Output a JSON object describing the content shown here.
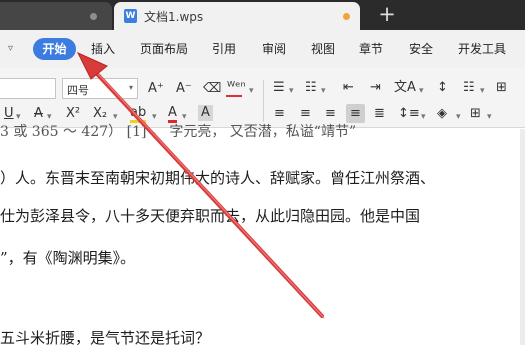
{
  "tabs": {
    "active_title": "文档1.wps",
    "doc_icon_letter": "W",
    "new_tab_symbol": "+"
  },
  "menu": {
    "chevron": "▿",
    "items": [
      "开始",
      "插入",
      "页面布局",
      "引用",
      "审阅",
      "视图",
      "章节",
      "安全",
      "开发工具"
    ],
    "active_index": 0
  },
  "toolbar": {
    "font_size": "四号",
    "font_size_arrow": "▾",
    "grow_font": "A⁺",
    "shrink_font": "A⁻",
    "clear_format": "⌫",
    "pinyin": "ᵂᵉⁿ",
    "bullets": "☰",
    "numbering": "☷",
    "outdent": "⇤",
    "indent": "⇥",
    "text_direction": "文A",
    "sort": "↕",
    "underline": "U",
    "strike": "A",
    "superscript": "X²",
    "subscript": "X₂",
    "highlight": "ab",
    "font_color": "A",
    "char_shading": "A",
    "align_left": "≡",
    "align_center": "≡",
    "align_right": "≡",
    "align_justify": "≡",
    "distributed": "≣",
    "line_spacing": "↕≡",
    "shading": "◈",
    "borders": "⊞",
    "dropdown_arrow": "▾"
  },
  "colors": {
    "accent": "#3c7ce0",
    "tabbar": "#2b2b2b",
    "arrow": "#d93a3a"
  },
  "document": {
    "line1": "3 或 365 ～ 427） [1] ， 字元亮， 又否潜，私谥“靖节”",
    "line2": "）人。东晋末至南朝宋初期伟大的诗人、辞赋家。曾任江州祭酒、",
    "line3": "仕为彭泽县令，八十多天便弃职而去，从此归隐田园。他是中国",
    "line4": "”，有《陶渊明集》。",
    "line5": "五斗米折腰，是气节还是托词？"
  }
}
